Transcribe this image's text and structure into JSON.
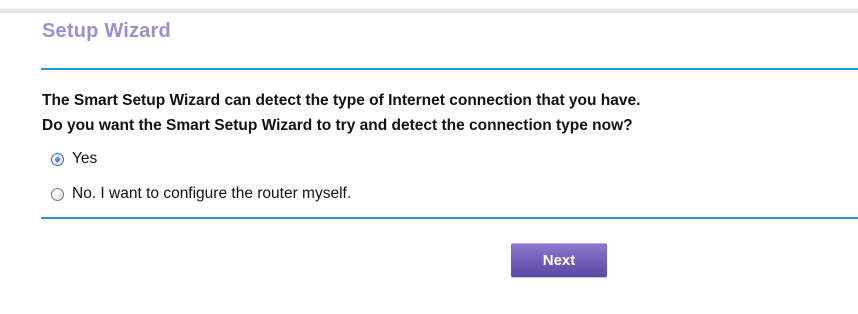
{
  "header": {
    "title": "Setup Wizard"
  },
  "content": {
    "question_line_1": "The Smart Setup Wizard can detect the type of Internet connection that you have.",
    "question_line_2": "Do you want the Smart Setup Wizard to try and detect the connection type now?"
  },
  "options": [
    {
      "label": "Yes",
      "selected": true
    },
    {
      "label": "No. I want to configure the router myself.",
      "selected": false
    }
  ],
  "actions": {
    "next_label": "Next"
  },
  "colors": {
    "title": "#9b8fd0",
    "rule": "#1b9bd6",
    "button": "#7561bd"
  }
}
